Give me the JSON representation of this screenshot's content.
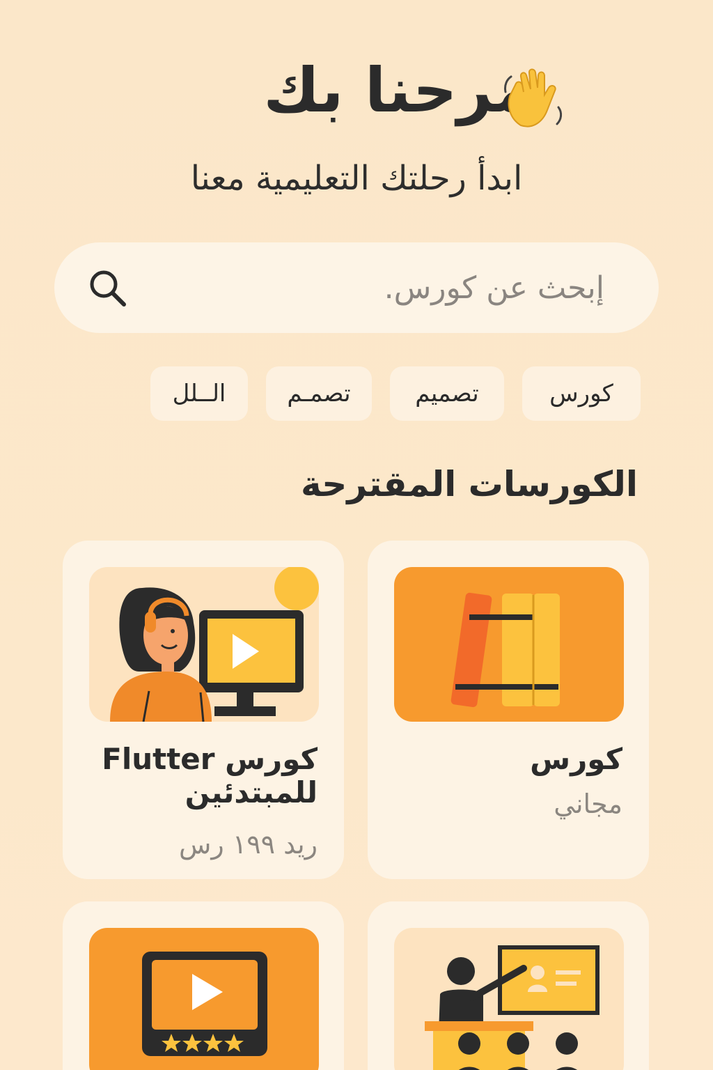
{
  "header": {
    "title": "مرحنا بك",
    "subtitle": "ابدأ  رحلتك التعليمية  معنا"
  },
  "search": {
    "placeholder": "إبحث عن كورس."
  },
  "chips": [
    "كورس",
    "تصميم",
    "تصمـم",
    "الــلل"
  ],
  "section": {
    "title": "الكورسات المقترحة"
  },
  "courses": [
    {
      "title": "كورس",
      "price": "مجاني"
    },
    {
      "title": "كورس Flutter للمبتدئين",
      "price": "ريد ١٩٩ رس"
    }
  ],
  "colors": {
    "background": "#fbe7c9",
    "accent": "#f79a2e",
    "card": "#fdf3e4"
  },
  "icons": [
    "waving-hand-icon",
    "search-icon",
    "books-icon",
    "video-player-icon",
    "presentation-icon"
  ]
}
